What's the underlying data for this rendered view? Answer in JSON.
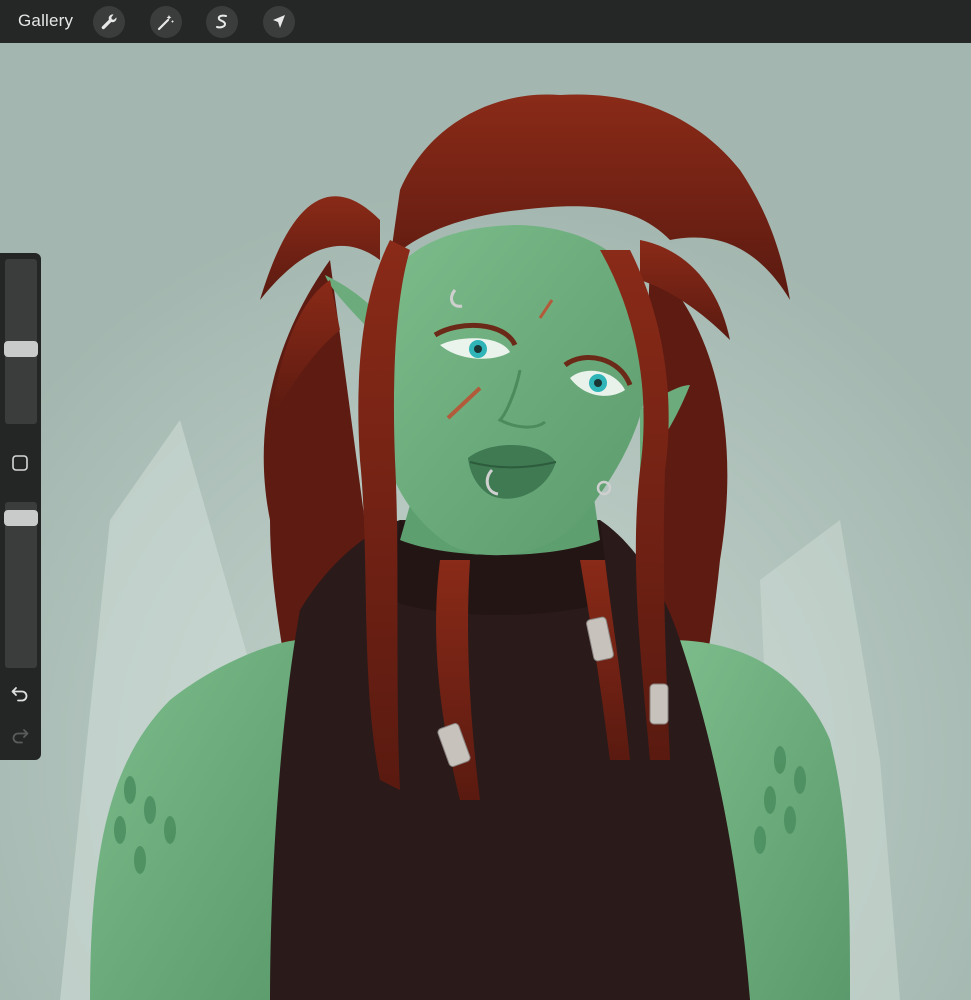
{
  "topbar": {
    "gallery_label": "Gallery",
    "tools": [
      {
        "icon": "wrench-icon",
        "name": "actions"
      },
      {
        "icon": "magic-wand-icon",
        "name": "adjustments"
      },
      {
        "icon": "selection-icon",
        "name": "selection"
      },
      {
        "icon": "arrow-cursor-icon",
        "name": "transform"
      }
    ]
  },
  "sidebar": {
    "brush_size": 0.55,
    "opacity": 0.04,
    "modify_icon": "square-icon",
    "undo_icon": "undo-icon",
    "redo_icon": "redo-icon"
  },
  "colors": {
    "background": "#a3b7b0",
    "skin": "#6fae7e",
    "hair": "#6b2015",
    "top": "#2a1a1a",
    "ui_dark": "#252626"
  }
}
